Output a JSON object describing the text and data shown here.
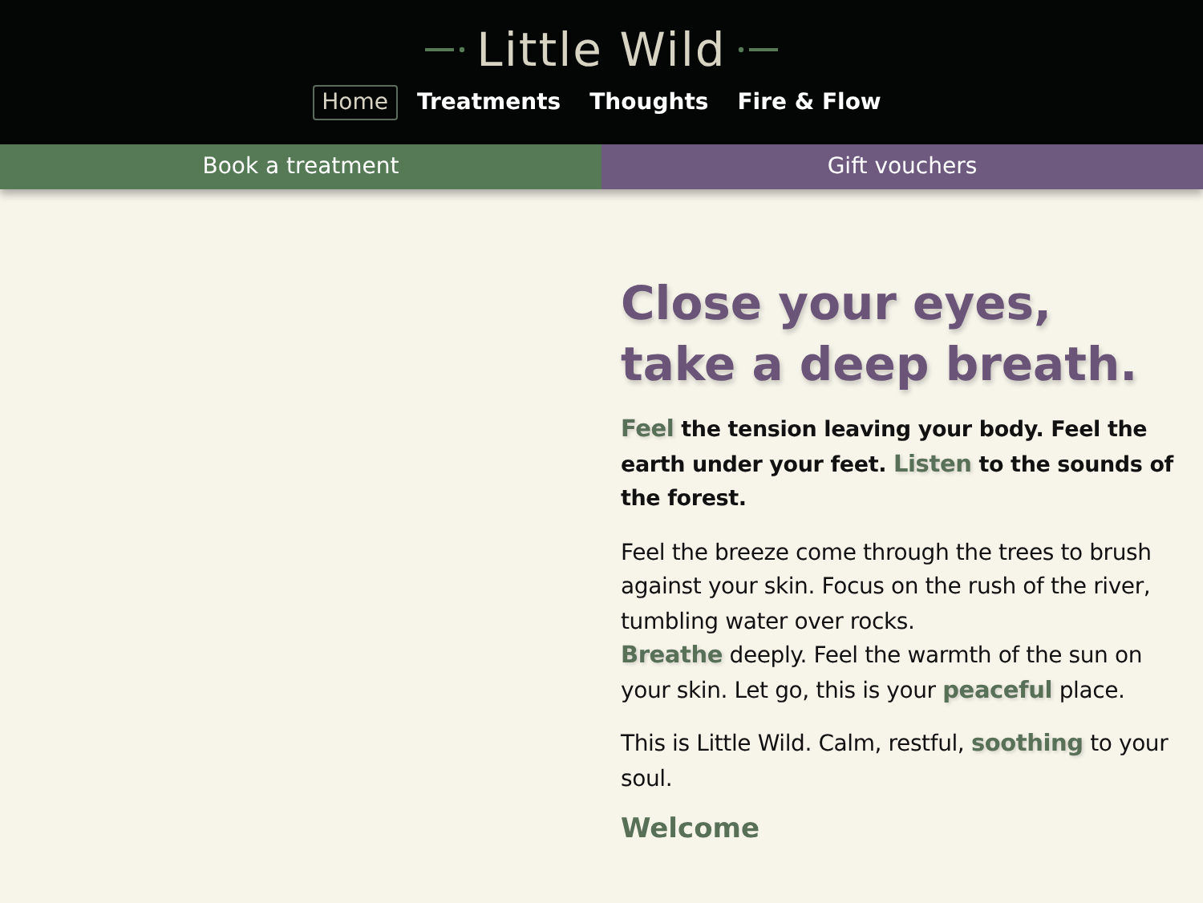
{
  "site": {
    "logo": "Little Wild"
  },
  "nav": [
    {
      "label": "Home",
      "selected": true
    },
    {
      "label": "Treatments",
      "selected": false
    },
    {
      "label": "Thoughts",
      "selected": false
    },
    {
      "label": "Fire & Flow",
      "selected": false
    }
  ],
  "actions": [
    {
      "label": "Book a treatment",
      "color": "#557a55"
    },
    {
      "label": "Gift vouchers",
      "color": "#6e5a7e"
    }
  ],
  "content": {
    "heading_lines": [
      "Close your eyes,",
      "take a deep breath."
    ],
    "paragraphs": [
      {
        "kind": "lead",
        "text": "*Feel* the tension leaving your body. Feel the earth under your feet. *Listen* to the sounds of the forest."
      },
      {
        "kind": "body",
        "text": "Feel the breeze come through the trees to brush against your skin. Focus on the rush of the river, tumbling water over rocks."
      },
      {
        "kind": "join",
        "text": "*Breathe* deeply. Feel the warmth of the sun on your skin. Let go, this is your *peaceful* place."
      },
      {
        "kind": "body",
        "text": "This is Little Wild. Calm, restful, *soothing* to your soul."
      }
    ],
    "subheading": "Welcome"
  }
}
